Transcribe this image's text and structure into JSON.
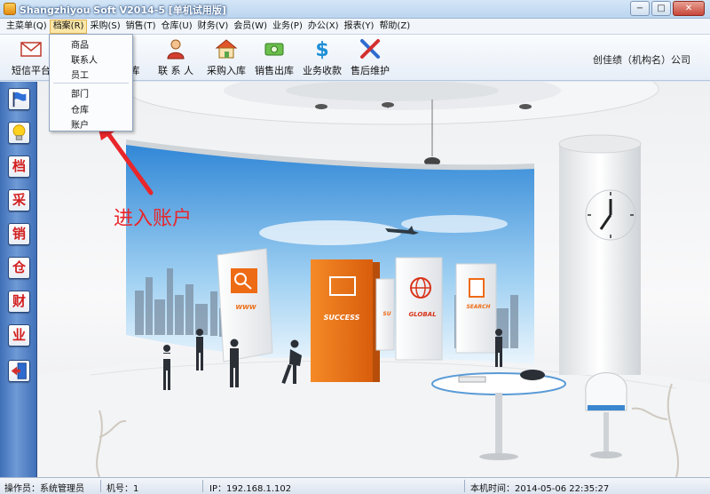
{
  "window": {
    "title": "Shangzhiyou Soft V2014-5 [单机试用版]",
    "controls": {
      "minimize": "−",
      "maximize": "□",
      "close": "✕"
    }
  },
  "menu": {
    "items": [
      {
        "label": "主菜单(Q)",
        "active": false
      },
      {
        "label": "档案(R)",
        "active": true
      },
      {
        "label": "采购(S)",
        "active": false
      },
      {
        "label": "销售(T)",
        "active": false
      },
      {
        "label": "仓库(U)",
        "active": false
      },
      {
        "label": "财务(V)",
        "active": false
      },
      {
        "label": "会员(W)",
        "active": false
      },
      {
        "label": "业务(P)",
        "active": false
      },
      {
        "label": "办公(X)",
        "active": false
      },
      {
        "label": "报表(Y)",
        "active": false
      },
      {
        "label": "帮助(Z)",
        "active": false
      }
    ]
  },
  "dropdown": {
    "items": [
      {
        "label": "商品"
      },
      {
        "label": "联系人"
      },
      {
        "label": "员工"
      },
      {
        "label": "部门"
      },
      {
        "label": "仓库"
      },
      {
        "label": "账户"
      }
    ]
  },
  "toolbar": {
    "items": [
      {
        "label": "短信平台",
        "icon": "envelope-icon"
      },
      {
        "label": "库",
        "icon": "warehouse-icon"
      },
      {
        "label": "联 系 人",
        "icon": "contact-person-icon"
      },
      {
        "label": "采购入库",
        "icon": "purchase-house-icon"
      },
      {
        "label": "销售出库",
        "icon": "sales-money-icon"
      },
      {
        "label": "业务收款",
        "icon": "dollar-icon"
      },
      {
        "label": "售后维护",
        "icon": "tools-icon"
      }
    ],
    "company": "创佳绩（机构名）公司"
  },
  "sidebar": {
    "items": [
      {
        "icon": "flag-icon",
        "char": ""
      },
      {
        "icon": "lightbulb-icon",
        "char": ""
      },
      {
        "icon": "archive-icon",
        "char": "档"
      },
      {
        "icon": "purchase-icon",
        "char": "采"
      },
      {
        "icon": "sales-icon",
        "char": "销"
      },
      {
        "icon": "warehouse-icon",
        "char": "仓"
      },
      {
        "icon": "finance-icon",
        "char": "财"
      },
      {
        "icon": "business-icon",
        "char": "业"
      },
      {
        "icon": "exit-icon",
        "char": ""
      }
    ]
  },
  "annotation": {
    "text": "进入账户",
    "color": "#e8262b"
  },
  "banner": {
    "signs": [
      "WWW",
      "SUCCESS",
      "SU",
      "GLOBAL",
      "SEARCH"
    ]
  },
  "status": {
    "operator": "操作员：系统管理员",
    "machine": "机号：1",
    "ip": "IP：192.168.1.102",
    "time": "本机时间：2014-05-06 22:35:27"
  },
  "colors": {
    "accent_orange": "#f07a1f",
    "sidebar_blue": "#4a78bf",
    "sign_red": "#d21e1e"
  }
}
